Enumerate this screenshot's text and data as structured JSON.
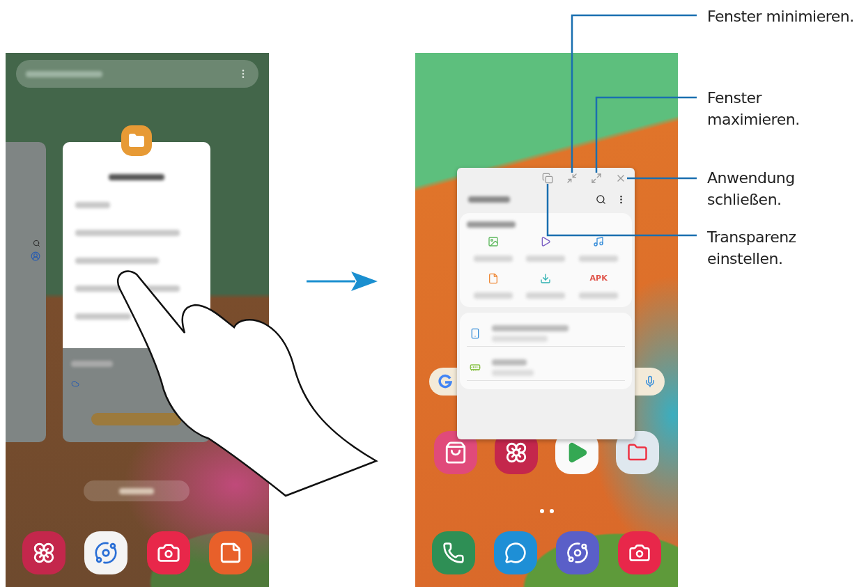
{
  "right_screen": {
    "popup": {
      "categories": [
        {
          "kind": "images"
        },
        {
          "kind": "videos"
        },
        {
          "kind": "audio"
        },
        {
          "kind": "documents"
        },
        {
          "kind": "downloads"
        },
        {
          "kind": "apk",
          "label": "APK"
        }
      ]
    }
  },
  "callouts": [
    {
      "kind": "minimize",
      "lines": [
        "Fenster minimieren."
      ]
    },
    {
      "kind": "maximize",
      "lines": [
        "Fenster",
        "maximieren."
      ]
    },
    {
      "kind": "close",
      "lines": [
        "Anwendung",
        "schließen."
      ]
    },
    {
      "kind": "transparency",
      "lines": [
        "Transparenz",
        "einstellen."
      ]
    }
  ]
}
